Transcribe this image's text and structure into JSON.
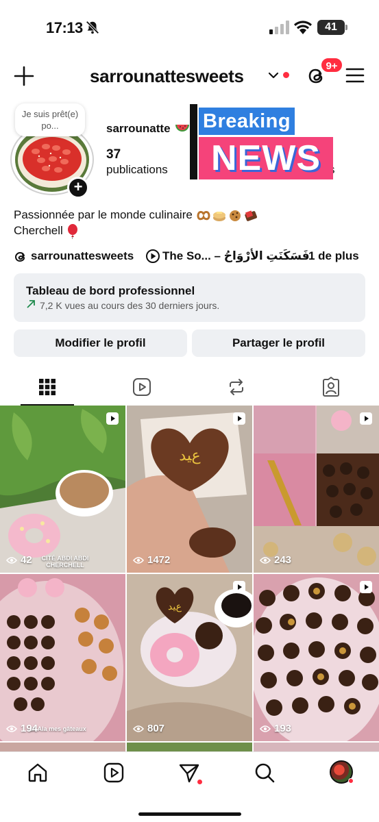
{
  "status": {
    "time": "17:13",
    "battery": "41"
  },
  "header": {
    "username": "sarrounattesweets",
    "notification_count": "9+"
  },
  "profile": {
    "note": "Je suis prêt(e) po...",
    "display_name": "sarrounatte",
    "posts_count": "37",
    "posts_label": "publications",
    "truncated_stat_tail": "s",
    "overlay": {
      "line1": "Breaking",
      "line2": "NEWS"
    },
    "bio_line1": "Passionnée par le monde culinaire",
    "bio_line2": "Cherchell"
  },
  "links": {
    "threads_handle": "sarrounattesweets",
    "music": "The So... – فَسَكَنَتِ الأرْوَاحُ",
    "more": "1 de plus"
  },
  "dashboard": {
    "title": "Tableau de bord professionnel",
    "subtitle": "7,2 K vues au cours des 30 derniers jours."
  },
  "buttons": {
    "edit": "Modifier le profil",
    "share": "Partager le profil"
  },
  "tabs": [
    {
      "icon": "grid-icon",
      "active": true
    },
    {
      "icon": "reels-icon",
      "active": false
    },
    {
      "icon": "repost-icon",
      "active": false
    },
    {
      "icon": "tagged-icon",
      "active": false
    }
  ],
  "posts": [
    {
      "views": "42",
      "caption": "CITÉ ABDI ABDI CHERCHELL",
      "reel": true
    },
    {
      "views": "1472",
      "caption": "",
      "reel": true
    },
    {
      "views": "243",
      "caption": "",
      "reel": true
    },
    {
      "views": "194",
      "caption": "ah Ala mes gâteaux",
      "reel": false
    },
    {
      "views": "807",
      "caption": "",
      "reel": true
    },
    {
      "views": "193",
      "caption": "",
      "reel": true
    }
  ],
  "colors": {
    "accent_red": "#ff2d40",
    "button_bg": "#eef0f3",
    "breaking_blue": "#2f7fe0",
    "breaking_pink": "#f5437a"
  }
}
